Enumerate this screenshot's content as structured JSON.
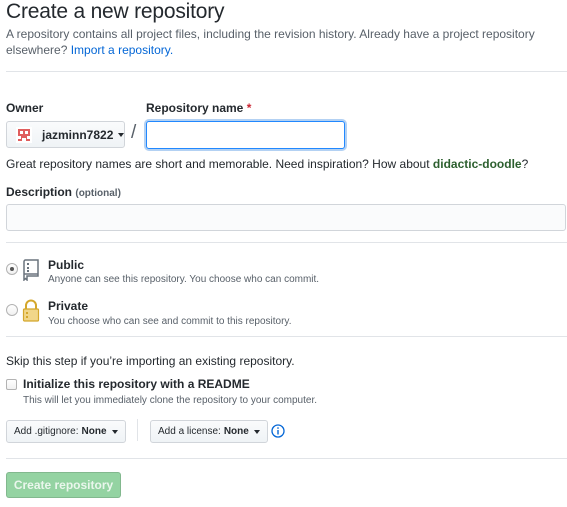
{
  "header": {
    "title": "Create a new repository",
    "description": "A repository contains all project files, including the revision history. Already have a project repository elsewhere?",
    "import_link": "Import a repository."
  },
  "owner": {
    "label": "Owner",
    "username": "jazminn7822"
  },
  "repo_name": {
    "label": "Repository name",
    "required_mark": "*",
    "separator": "/",
    "value": ""
  },
  "hint": {
    "text": "Great repository names are short and memorable. Need inspiration? How about",
    "suggestion": "didactic-doodle",
    "suffix": "?"
  },
  "description": {
    "label": "Description",
    "optional": "(optional)",
    "value": ""
  },
  "visibility": {
    "selected": "public",
    "options": [
      {
        "title": "Public",
        "desc": "Anyone can see this repository. You choose who can commit.",
        "icon": "repo-icon"
      },
      {
        "title": "Private",
        "desc": "You choose who can see and commit to this repository.",
        "icon": "lock-icon"
      }
    ]
  },
  "init": {
    "skip_note": "Skip this step if you’re importing an existing repository.",
    "readme_label": "Initialize this repository with a README",
    "readme_note": "This will let you immediately clone the repository to your computer.",
    "readme_checked": false
  },
  "gitignore": {
    "label": "Add .gitignore:",
    "value": "None"
  },
  "license": {
    "label": "Add a license:",
    "value": "None"
  },
  "submit": {
    "label": "Create repository"
  },
  "colors": {
    "accent": "#0366d6",
    "create_button_disabled": "#94d3a2",
    "required": "#cb2431"
  }
}
